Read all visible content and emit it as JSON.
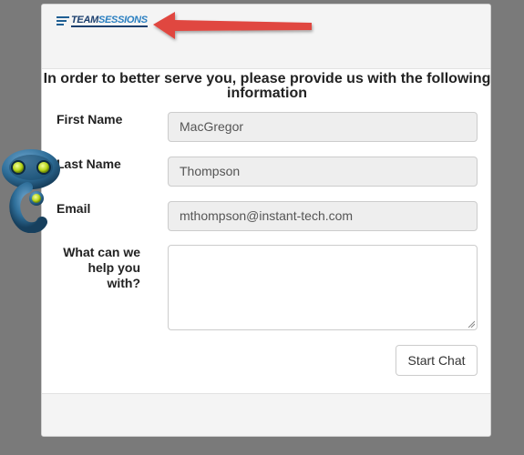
{
  "brand": {
    "logo_text_dark": "TEAM",
    "logo_text_accent": "SESSIONS"
  },
  "form": {
    "heading": "In order to better serve you, please provide us with the following information",
    "first_name": {
      "label": "First Name",
      "value": "MacGregor"
    },
    "last_name": {
      "label": "Last Name",
      "value": "Thompson"
    },
    "email": {
      "label": "Email",
      "value": "mthompson@instant-tech.com"
    },
    "message": {
      "label": "What can we help you with?",
      "value": ""
    },
    "submit_label": "Start Chat"
  },
  "colors": {
    "backdrop": "#7a7a7a",
    "annotation_arrow": "#e0463f",
    "brand_blue": "#1c3f6e",
    "robot_body": "#2f6f9a"
  },
  "icons": {
    "annotation": "red-arrow-pointing-left",
    "mascot": "robot-icon"
  }
}
